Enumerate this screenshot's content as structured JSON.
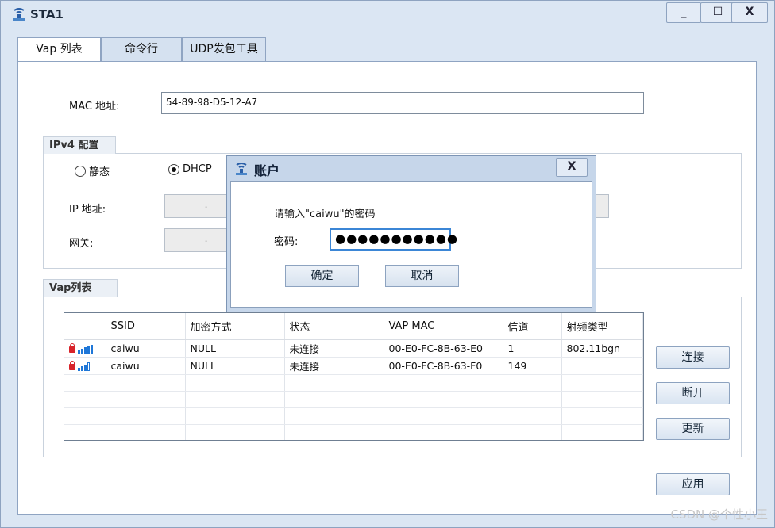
{
  "window": {
    "title": "STA1",
    "minimize": "_",
    "maximize": "☐",
    "close": "X"
  },
  "tabs": [
    {
      "label": "Vap 列表",
      "active": true
    },
    {
      "label": "命令行",
      "active": false
    },
    {
      "label": "UDP发包工具",
      "active": false
    }
  ],
  "mac": {
    "label": "MAC 地址:",
    "value": "54-89-98-D5-12-A7"
  },
  "ipv4": {
    "title": "IPv4 配置",
    "static_label": "静态",
    "dhcp_label": "DHCP",
    "selected": "DHCP",
    "ip_label": "IP 地址:",
    "gateway_label": "网关:",
    "ip_placeholder": ".",
    "gateway_placeholder": "."
  },
  "vap": {
    "title": "Vap列表",
    "columns": [
      "",
      "SSID",
      "加密方式",
      "状态",
      "VAP MAC",
      "信道",
      "射频类型"
    ],
    "rows": [
      {
        "ssid": "caiwu",
        "encryption": "NULL",
        "status": "未连接",
        "vap_mac": "00-E0-FC-8B-63-E0",
        "channel": "1",
        "radio": "802.11bgn",
        "signal": 4
      },
      {
        "ssid": "caiwu",
        "encryption": "NULL",
        "status": "未连接",
        "vap_mac": "00-E0-FC-8B-63-F0",
        "channel": "149",
        "radio": "",
        "signal": 3
      }
    ]
  },
  "buttons": {
    "connect": "连接",
    "disconnect": "断开",
    "refresh": "更新",
    "apply": "应用"
  },
  "dialog": {
    "title": "账户",
    "close": "X",
    "prompt": "请输入\"caiwu\"的密码",
    "password_label": "密码:",
    "password_value": "●●●●●●●●●●●",
    "ok": "确定",
    "cancel": "取消"
  },
  "watermark": "CSDN @个性小王",
  "colors": {
    "window_bg": "#dbe6f3",
    "accent": "#3b86d6",
    "lock": "#d8232a",
    "signal": "#1f77d8"
  }
}
